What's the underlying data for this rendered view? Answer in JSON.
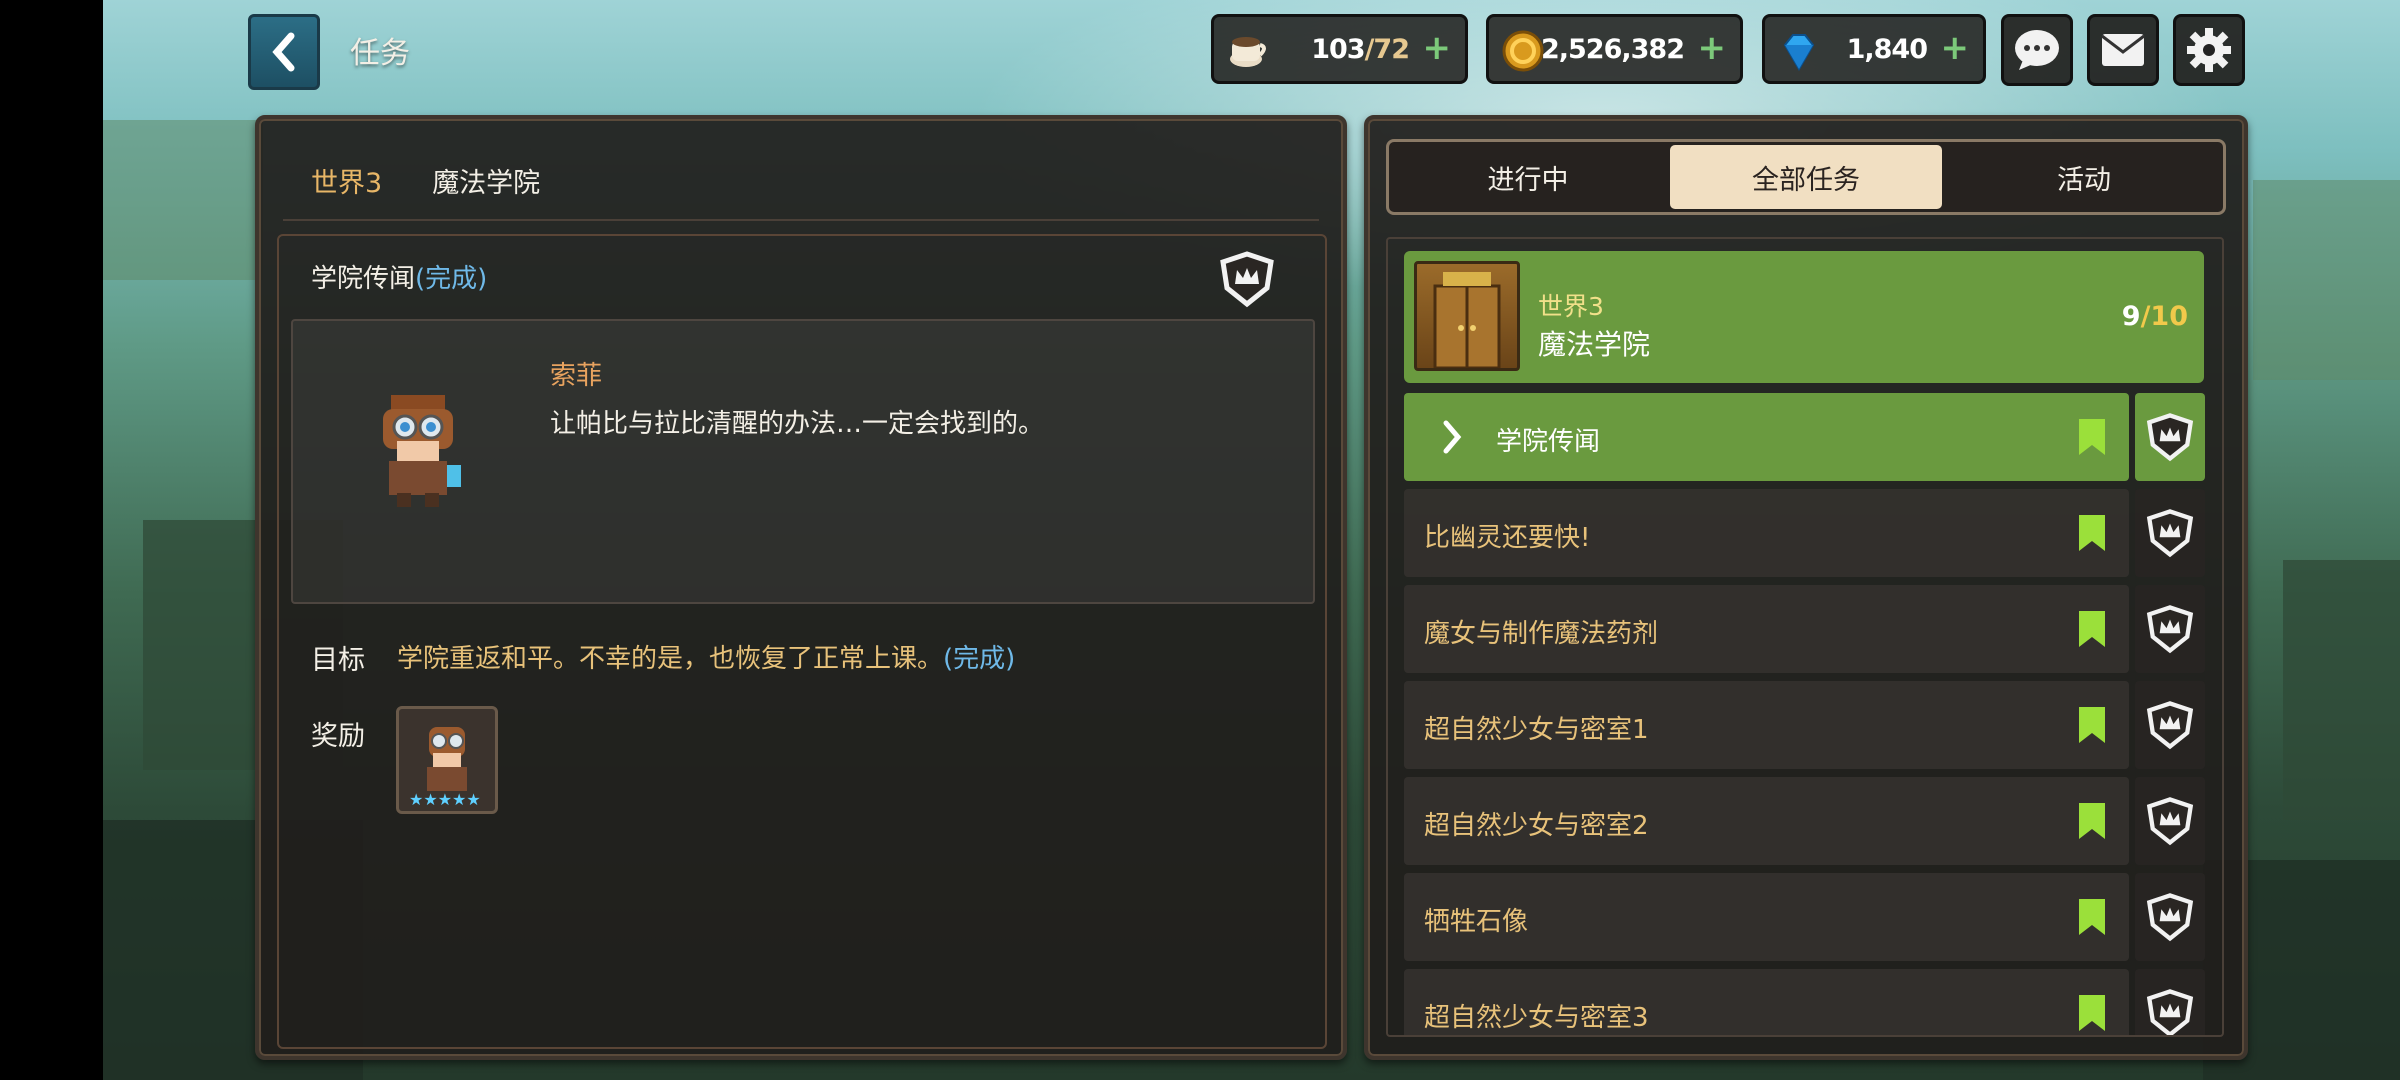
{
  "header": {
    "title": "任务",
    "resources": [
      {
        "name": "stamina",
        "icon": "coffee-cup-icon",
        "value": "103",
        "max": "/72"
      },
      {
        "name": "gold",
        "icon": "gold-coin-icon",
        "value": "2,526,382",
        "max": ""
      },
      {
        "name": "gems",
        "icon": "diamond-icon",
        "value": "1,840",
        "max": ""
      }
    ]
  },
  "left": {
    "world": "世界3",
    "world_name": "魔法学院",
    "quest": {
      "title": "学院传闻",
      "status": "(完成)",
      "npc_name": "索菲",
      "dialog": "让帕比与拉比清醒的办法…一定会找到的。",
      "goal_label": "目标",
      "goal_text": "学院重返和平。不幸的是，也恢复了正常上课。",
      "goal_status": "(完成)",
      "reward_label": "奖励"
    }
  },
  "tabs": [
    "进行中",
    "全部任务",
    "活动"
  ],
  "active_tab": 1,
  "world_group": {
    "label": "世界3",
    "name": "魔法学院",
    "done": "9",
    "total": "/10"
  },
  "quests": [
    {
      "label": "学院传闻",
      "selected": true
    },
    {
      "label": "比幽灵还要快!",
      "selected": false
    },
    {
      "label": "魔女与制作魔法药剂",
      "selected": false
    },
    {
      "label": "超自然少女与密室1",
      "selected": false
    },
    {
      "label": "超自然少女与密室2",
      "selected": false
    },
    {
      "label": "牺牲石像",
      "selected": false
    },
    {
      "label": "超自然少女与密室3",
      "selected": false
    }
  ],
  "colors": {
    "accent_green": "#6a9a3f",
    "gold_text": "#e8c27a",
    "done_blue": "#6fb9e8",
    "bookmark_green": "#9be03a"
  }
}
